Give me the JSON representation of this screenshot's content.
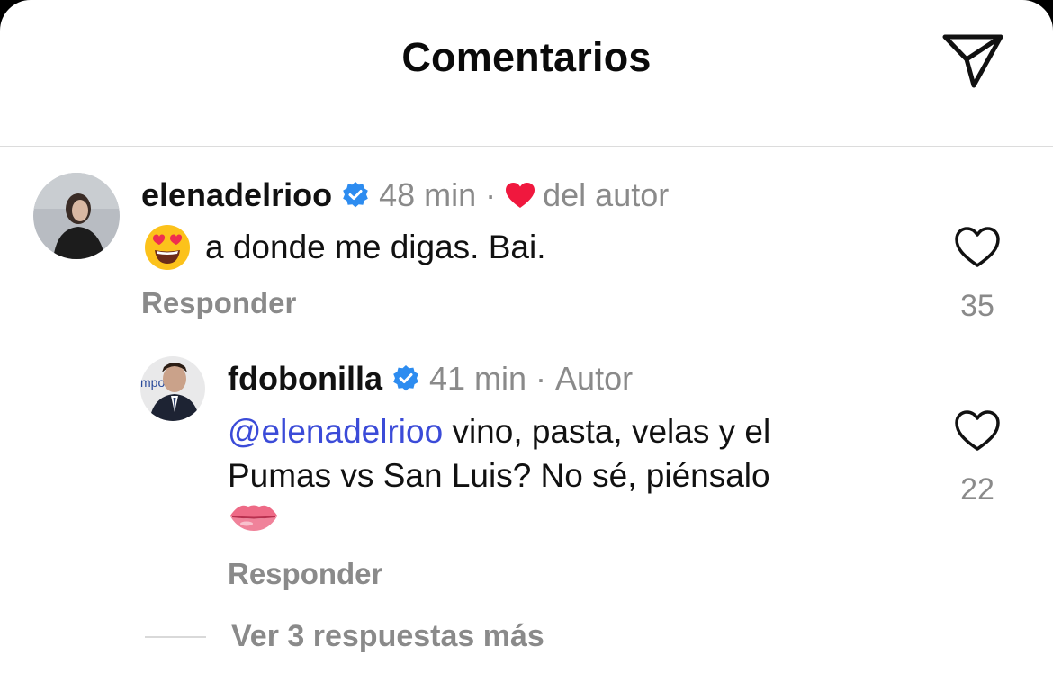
{
  "header": {
    "title": "Comentarios",
    "share_icon": "send-icon"
  },
  "comments": [
    {
      "username": "elenadelrioo",
      "time": "48 min",
      "dot": "·",
      "author_like_label": "del autor",
      "text": "a donde me digas. Bai.",
      "reply_label": "Responder",
      "likes": "35",
      "emoji": "heart-eyes-emoji",
      "accent_color": "#f0183e"
    }
  ],
  "reply": {
    "username": "fdobonilla",
    "time": "41 min",
    "dot": "·",
    "author_label": "Autor",
    "mention": "@elenadelrioo",
    "text_line1": " vino, pasta, velas y el",
    "text_line2": "Pumas vs San Luis? No sé, piénsalo",
    "emoji": "lips-emoji",
    "reply_label": "Responder",
    "likes": "22",
    "mention_color": "#3b4bd8"
  },
  "more_replies_label": "Ver 3 respuestas más",
  "verified_color": "#2d8cf0"
}
